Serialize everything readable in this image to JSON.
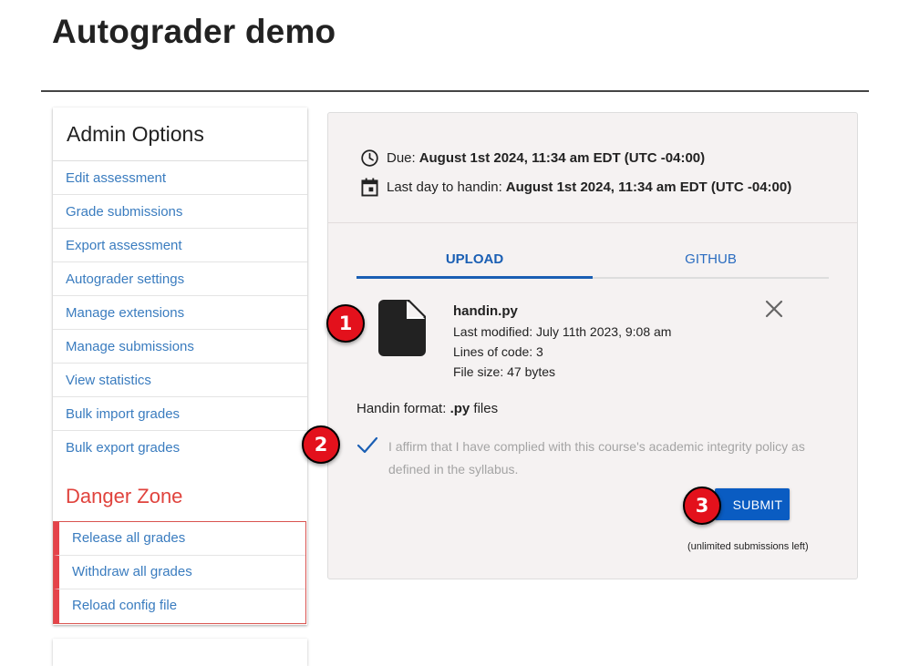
{
  "page": {
    "title": "Autograder demo"
  },
  "sidebar": {
    "heading": "Admin Options",
    "items": [
      "Edit assessment",
      "Grade submissions",
      "Export assessment",
      "Autograder settings",
      "Manage extensions",
      "Manage submissions",
      "View statistics",
      "Bulk import grades",
      "Bulk export grades"
    ],
    "danger_heading": "Danger Zone",
    "danger_items": [
      "Release all grades",
      "Withdraw all grades",
      "Reload config file"
    ]
  },
  "due": {
    "due_label": "Due:",
    "due_value": "August 1st 2024, 11:34 am EDT (UTC -04:00)",
    "last_label": "Last day to handin:",
    "last_value": "August 1st 2024, 11:34 am EDT (UTC -04:00)"
  },
  "tabs": {
    "upload": "UPLOAD",
    "github": "GITHUB"
  },
  "file": {
    "name": "handin.py",
    "modified": "Last modified: July 11th 2023, 9:08 am",
    "lines": "Lines of code: 3",
    "size": "File size: 47 bytes"
  },
  "handin": {
    "format_label": "Handin format:",
    "format_value": ".py",
    "format_suffix": "files",
    "affirm": "I affirm that I have complied with this course's academic integrity policy as defined in the syllabus."
  },
  "submit": {
    "label": "SUBMIT",
    "remaining": "(unlimited submissions left)"
  },
  "badges": {
    "one": "1",
    "two": "2",
    "three": "3"
  },
  "colors": {
    "accent": "#0a5cc2",
    "link": "#3a7cbf",
    "danger": "#e0433d",
    "badge": "#e3111c"
  }
}
